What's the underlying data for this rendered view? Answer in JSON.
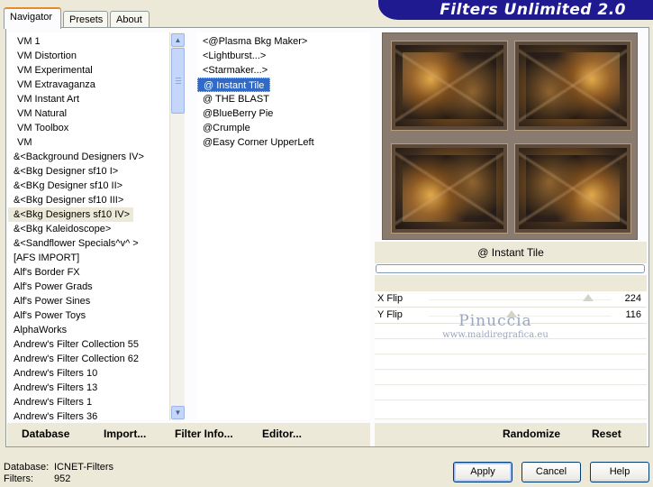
{
  "header": {
    "title": "Filters Unlimited 2.0"
  },
  "tabs": [
    {
      "label": "Navigator",
      "active": true
    },
    {
      "label": "Presets"
    },
    {
      "label": "About"
    }
  ],
  "categories": [
    "VM 1",
    "VM Distortion",
    "VM Experimental",
    "VM Extravaganza",
    "VM Instant Art",
    "VM Natural",
    "VM Toolbox",
    "VM",
    "&<Background Designers IV>",
    "&<Bkg Designer sf10 I>",
    "&<BKg Designer sf10 II>",
    "&<Bkg Designer sf10 III>",
    "&<Bkg Designers sf10 IV>",
    "&<Bkg Kaleidoscope>",
    "&<Sandflower Specials^v^ >",
    "[AFS IMPORT]",
    "Alf's Border FX",
    "Alf's Power Grads",
    "Alf's Power Sines",
    "Alf's Power Toys",
    "AlphaWorks",
    "Andrew's Filter Collection 55",
    "Andrew's Filter Collection 62",
    "Andrew's Filters 10",
    "Andrew's Filters 13",
    "Andrew's Filters 1",
    "Andrew's Filters 36"
  ],
  "selected_category": "&<Bkg Designers sf10 IV>",
  "filters": [
    "<@Plasma Bkg Maker>",
    "<Lightburst...>",
    "<Starmaker...>",
    "@ Instant Tile",
    "@ THE BLAST",
    "@BlueBerry Pie",
    "@Crumple",
    "@Easy Corner UpperLeft"
  ],
  "selected_filter": "@ Instant Tile",
  "preview": {
    "filter_name": "@ Instant Tile"
  },
  "sliders": [
    {
      "label": "X Flip",
      "value": "224",
      "level": 224
    },
    {
      "label": "Y Flip",
      "value": "116",
      "level": 116
    }
  ],
  "watermark": {
    "title": "Pinuccia",
    "url": "www.maidiregrafica.eu"
  },
  "commands_left": [
    "Database",
    "Import...",
    "Filter Info...",
    "Editor..."
  ],
  "commands_right": [
    "Randomize",
    "Reset"
  ],
  "status": {
    "database_label": "Database:",
    "database_value": "ICNET-Filters",
    "filters_label": "Filters:",
    "filters_value": "952"
  },
  "buttons": {
    "apply": "Apply",
    "cancel": "Cancel",
    "help": "Help"
  },
  "colors": {
    "banner": "#1f1a8f",
    "selection": "#316ac5",
    "tab_accent": "#e68b2c"
  }
}
